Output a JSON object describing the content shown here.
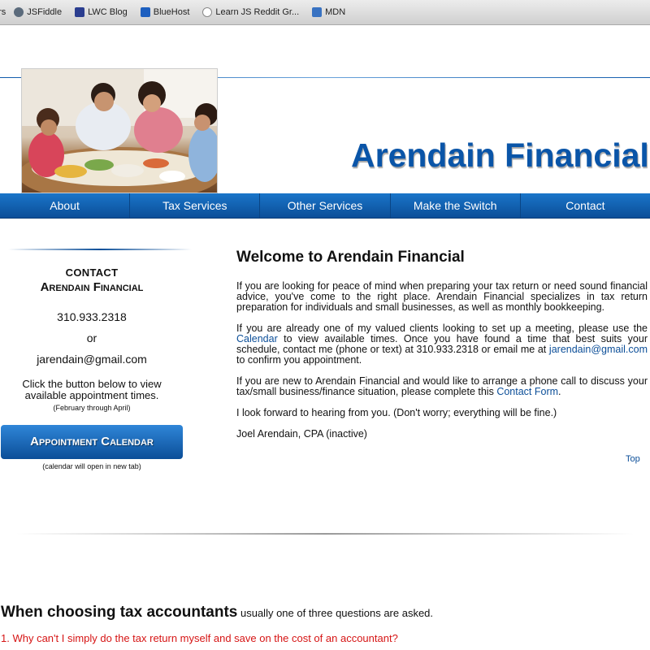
{
  "bookmarks": [
    {
      "label": "ers",
      "icon": "none"
    },
    {
      "label": "JSFiddle",
      "icon": "jsfiddle-icon"
    },
    {
      "label": "LWC Blog",
      "icon": "lwc-blog-icon"
    },
    {
      "label": "BlueHost",
      "icon": "bluehost-icon"
    },
    {
      "label": "Learn JS Reddit Gr...",
      "icon": "reddit-icon"
    },
    {
      "label": "MDN",
      "icon": "mdn-icon"
    }
  ],
  "header": {
    "brand": "Arendain Financial"
  },
  "nav": [
    "About",
    "Tax Services",
    "Other Services",
    "Make the Switch",
    "Contact"
  ],
  "sidebar": {
    "contact_head": "CONTACT",
    "contact_name": "Arendain Financial",
    "phone": "310.933.2318",
    "or": "or",
    "email": "jarendain@gmail.com",
    "note": "Click the button below to view available appointment times.",
    "note_small": "(February through April)",
    "button": "Appointment Calendar",
    "button_note": "(calendar will open in new tab)"
  },
  "main": {
    "title": "Welcome to Arendain Financial",
    "p1": "If you are looking for peace of mind when preparing your tax return or need sound financial advice, you've come to the right place. Arendain Financial specializes in tax return preparation for individuals and small businesses, as well as monthly bookkeeping.",
    "p2_a": "If you are already one of my valued clients looking to set up a meeting, please use the ",
    "p2_link": "Calendar",
    "p2_b": " to view available times. Once you have found a time that best suits your schedule, contact me (phone or text) at 310.933.2318 or email me at ",
    "p2_email": "jarendain@gmail.com",
    "p2_c": " to confirm you appointment.",
    "p3_a": "If you are new to Arendain Financial and would like to arrange a phone call to discuss your tax/small business/finance situation, please complete this ",
    "p3_link": "Contact Form",
    "p3_b": ".",
    "p4": "I look forward to hearing from you. (Don't worry; everything will be fine.)",
    "signature": "Joel Arendain, CPA (inactive)",
    "top_link": "Top"
  },
  "questions": {
    "heading_big": "When choosing tax accountants",
    "heading_small": " usually one of three questions are asked.",
    "q1": "1. Why can't I simply do the tax return myself and save on the cost of an accountant?"
  },
  "colors": {
    "brand_blue": "#0a55a8",
    "nav_blue": "#0b4e98",
    "question_red": "#d61515"
  }
}
